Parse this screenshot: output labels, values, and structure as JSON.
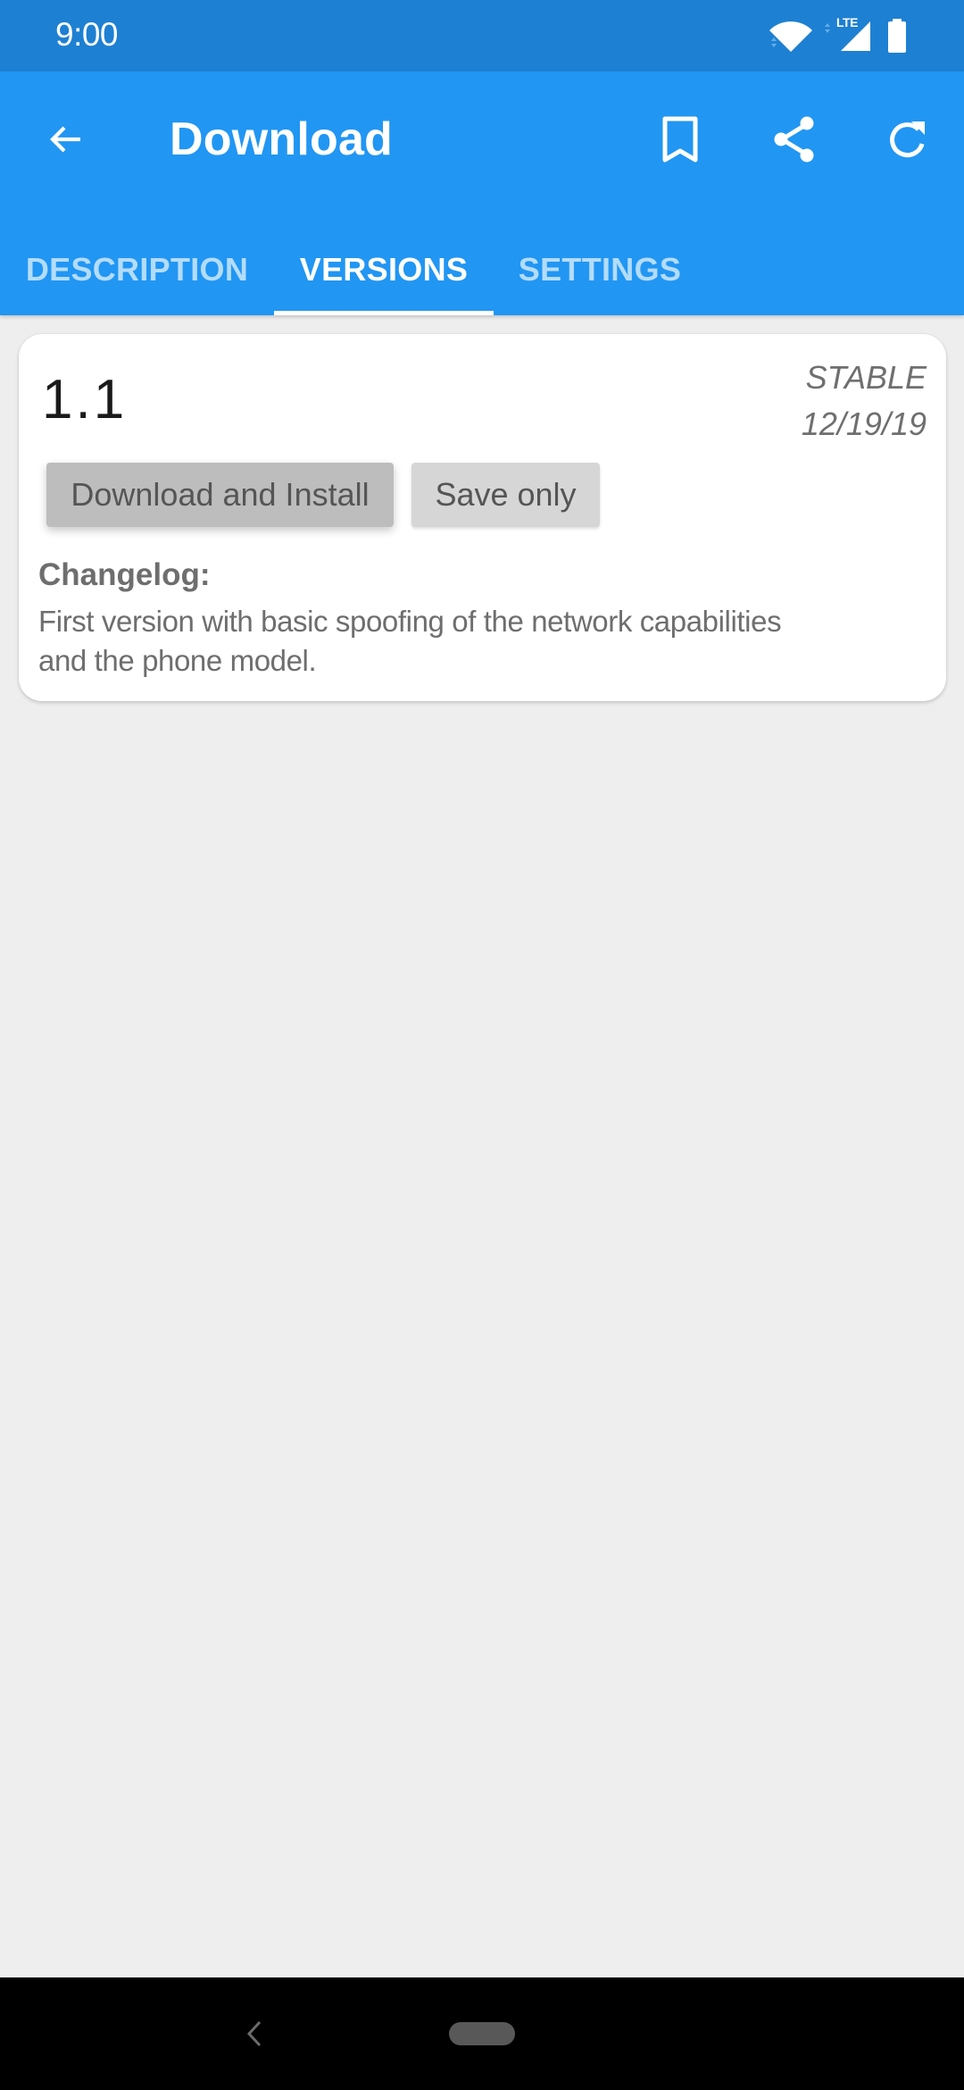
{
  "status_bar": {
    "time": "9:00",
    "network_label": "LTE",
    "icons": [
      "wifi-icon",
      "signal-icon",
      "battery-icon"
    ]
  },
  "app_bar": {
    "title": "Download",
    "back_icon": "arrow-left",
    "actions": [
      {
        "name": "bookmark",
        "icon": "bookmark-outline"
      },
      {
        "name": "share",
        "icon": "share"
      },
      {
        "name": "refresh",
        "icon": "refresh"
      }
    ],
    "colors": {
      "status_bar": "#1e80d2",
      "app_bar": "#2196f3",
      "tab_inactive": "#b3dcfb",
      "tab_active": "#ffffff"
    }
  },
  "tabs": [
    {
      "label": "DESCRIPTION",
      "active": false
    },
    {
      "label": "VERSIONS",
      "active": true
    },
    {
      "label": "SETTINGS",
      "active": false
    }
  ],
  "versions": [
    {
      "version": "1.1",
      "release_type": "STABLE",
      "date": "12/19/19",
      "buttons": {
        "download_install": "Download and Install",
        "save_only": "Save only"
      },
      "changelog_label": "Changelog:",
      "changelog_lines": [
        "First version with basic spoofing of the network capabilities",
        "and the phone model."
      ]
    }
  ],
  "nav_bar": {
    "back_icon": "chevron-left",
    "home_icon": "home-pill"
  }
}
